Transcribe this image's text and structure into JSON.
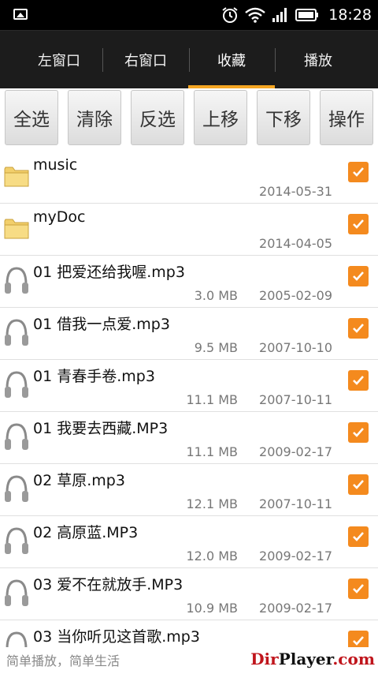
{
  "status_bar": {
    "time": "18:28",
    "icons": [
      "image-notification-icon",
      "alarm-icon",
      "wifi-icon",
      "signal-icon",
      "battery-icon"
    ]
  },
  "tabs": [
    {
      "label": "左窗口",
      "active": false
    },
    {
      "label": "右窗口",
      "active": false
    },
    {
      "label": "收藏",
      "active": true
    },
    {
      "label": "播放",
      "active": false
    }
  ],
  "toolbar": {
    "select_all": "全选",
    "clear": "清除",
    "invert": "反选",
    "move_up": "上移",
    "move_down": "下移",
    "actions": "操作"
  },
  "files": [
    {
      "name": "music",
      "size": "",
      "date": "2014-05-31",
      "type": "folder",
      "checked": true
    },
    {
      "name": "myDoc",
      "size": "",
      "date": "2014-04-05",
      "type": "folder",
      "checked": true
    },
    {
      "name": "01 把爱还给我喔.mp3",
      "size": "3.0 MB",
      "date": "2005-02-09",
      "type": "audio",
      "checked": true
    },
    {
      "name": "01 借我一点爱.mp3",
      "size": "9.5 MB",
      "date": "2007-10-10",
      "type": "audio",
      "checked": true
    },
    {
      "name": "01 青春手卷.mp3",
      "size": "11.1 MB",
      "date": "2007-10-11",
      "type": "audio",
      "checked": true
    },
    {
      "name": "01 我要去西藏.MP3",
      "size": "11.1 MB",
      "date": "2009-02-17",
      "type": "audio",
      "checked": true
    },
    {
      "name": "02 草原.mp3",
      "size": "12.1 MB",
      "date": "2007-10-11",
      "type": "audio",
      "checked": true
    },
    {
      "name": "02 高原蓝.MP3",
      "size": "12.0 MB",
      "date": "2009-02-17",
      "type": "audio",
      "checked": true
    },
    {
      "name": "03 爱不在就放手.MP3",
      "size": "10.9 MB",
      "date": "2009-02-17",
      "type": "audio",
      "checked": true
    },
    {
      "name": "03 当你听见这首歌.mp3",
      "size": "",
      "date": "",
      "type": "audio",
      "checked": true
    }
  ],
  "footer": {
    "slogan": "简单播放，简单生活",
    "brand_prefix": "Dir",
    "brand_main": "Player",
    "brand_suffix": ".com"
  },
  "colors": {
    "accent": "#f5a623",
    "checkbox": "#f48a1e",
    "brand_red": "#c0151c"
  }
}
